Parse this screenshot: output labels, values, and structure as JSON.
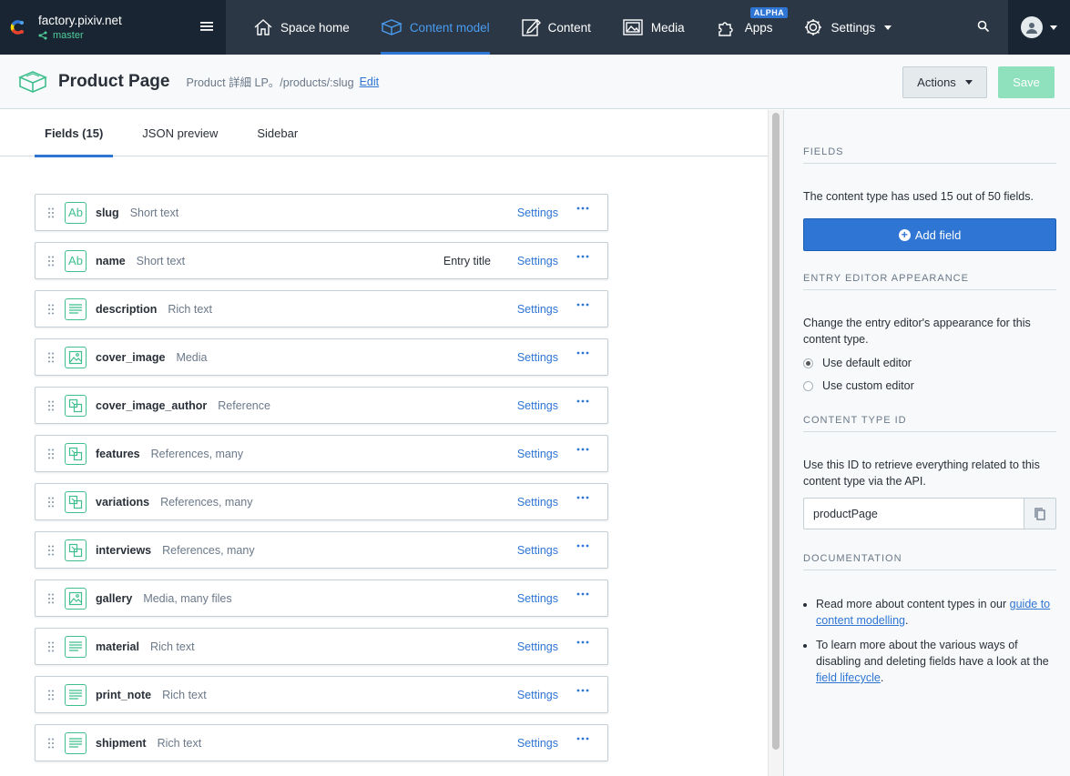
{
  "space": {
    "name": "factory.pixiv.net",
    "environment": "master"
  },
  "nav": {
    "items": [
      {
        "label": "Space home",
        "icon": "home-icon"
      },
      {
        "label": "Content model",
        "icon": "content-model-icon"
      },
      {
        "label": "Content",
        "icon": "content-icon"
      },
      {
        "label": "Media",
        "icon": "media-icon"
      },
      {
        "label": "Apps",
        "icon": "apps-icon",
        "badge": "ALPHA"
      },
      {
        "label": "Settings",
        "icon": "gear-icon"
      }
    ]
  },
  "header": {
    "title": "Product Page",
    "description": "Product 詳細 LP。/products/:slug",
    "edit_label": "Edit",
    "actions_label": "Actions",
    "save_label": "Save"
  },
  "tabs": [
    "Fields (15)",
    "JSON preview",
    "Sidebar"
  ],
  "fields": [
    {
      "name": "slug",
      "type": "Short text",
      "icon": "text-icon",
      "meta": ""
    },
    {
      "name": "name",
      "type": "Short text",
      "icon": "text-icon",
      "meta": "Entry title"
    },
    {
      "name": "description",
      "type": "Rich text",
      "icon": "richtext-icon",
      "meta": ""
    },
    {
      "name": "cover_image",
      "type": "Media",
      "icon": "media-icon",
      "meta": ""
    },
    {
      "name": "cover_image_author",
      "type": "Reference",
      "icon": "reference-icon",
      "meta": ""
    },
    {
      "name": "features",
      "type": "References, many",
      "icon": "reference-icon",
      "meta": ""
    },
    {
      "name": "variations",
      "type": "References, many",
      "icon": "reference-icon",
      "meta": ""
    },
    {
      "name": "interviews",
      "type": "References, many",
      "icon": "reference-icon",
      "meta": ""
    },
    {
      "name": "gallery",
      "type": "Media, many files",
      "icon": "media-icon",
      "meta": ""
    },
    {
      "name": "material",
      "type": "Rich text",
      "icon": "richtext-icon",
      "meta": ""
    },
    {
      "name": "print_note",
      "type": "Rich text",
      "icon": "richtext-icon",
      "meta": ""
    },
    {
      "name": "shipment",
      "type": "Rich text",
      "icon": "richtext-icon",
      "meta": ""
    }
  ],
  "field_settings_label": "Settings",
  "sidebar": {
    "fields_heading": "Fields",
    "fields_text": "The content type has used 15 out of 50 fields.",
    "add_field_label": "Add field",
    "appearance_heading": "Entry editor appearance",
    "appearance_text": "Change the entry editor's appearance for this content type.",
    "radio_default": "Use default editor",
    "radio_custom": "Use custom editor",
    "id_heading": "Content type ID",
    "id_text": "Use this ID to retrieve everything related to this content type via the API.",
    "id_value": "productPage",
    "doc_heading": "Documentation",
    "doc1_pre": "Read more about content types in our ",
    "doc1_link": "guide to content modelling",
    "doc1_post": ".",
    "doc2_pre": "To learn more about the various ways of disabling and deleting fields have a look at the ",
    "doc2_link": "field lifecycle",
    "doc2_post": "."
  },
  "colors": {
    "nav_bg": "#2b3745",
    "nav_dark": "#192532",
    "accent_blue": "#2e75d4",
    "accent_green": "#3fbf8e"
  }
}
